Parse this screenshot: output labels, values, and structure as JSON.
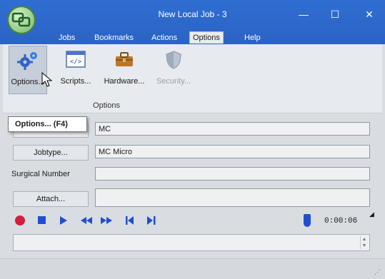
{
  "window": {
    "title": "New Local Job - 3",
    "controls": [
      "minimize",
      "maximize",
      "close"
    ]
  },
  "menu": [
    {
      "label": "Jobs"
    },
    {
      "label": "Bookmarks"
    },
    {
      "label": "Actions"
    },
    {
      "label": "Options",
      "active": true
    },
    {
      "label": "Help"
    }
  ],
  "ribbon": {
    "buttons": [
      {
        "label": "Options...",
        "icon": "gears-icon",
        "selected": true
      },
      {
        "label": "Scripts...",
        "icon": "script-icon"
      },
      {
        "label": "Hardware...",
        "icon": "toolbox-icon"
      },
      {
        "label": "Security...",
        "icon": "shield-icon",
        "disabled": true
      }
    ],
    "group_label": "Options"
  },
  "tooltip": "Options... (F4)",
  "form": {
    "row1_value": "MC",
    "jobtype_button": "Jobtype...",
    "jobtype_value": "MC Micro",
    "surgical_label": "Surgical Number",
    "surgical_value": "",
    "attach_button": "Attach...",
    "attach_value": ""
  },
  "transport": {
    "controls": [
      "record",
      "stop",
      "play",
      "rewind",
      "fast-forward",
      "skip-start",
      "skip-end"
    ],
    "time": "0:00:06"
  },
  "colors": {
    "titlebar": "#2a63c4",
    "accent_blue": "#1f4fd0",
    "record_red": "#d21f3c"
  }
}
